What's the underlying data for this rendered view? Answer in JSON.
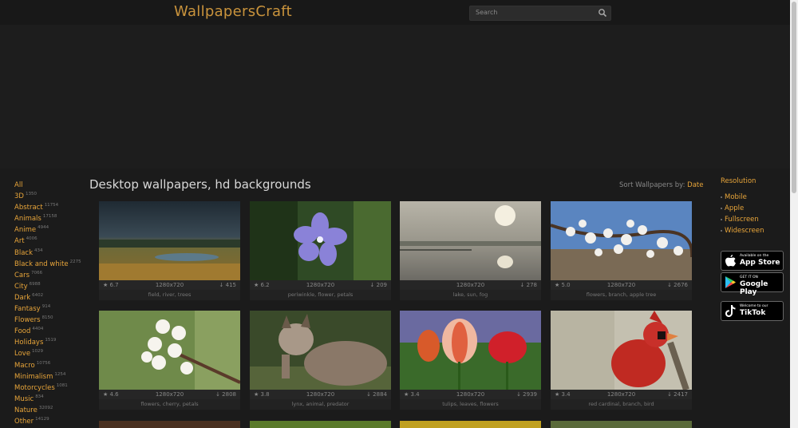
{
  "header": {
    "logo": "WallpapersCraft",
    "search_placeholder": "Search"
  },
  "title": "Desktop wallpapers, hd backgrounds",
  "sort": {
    "label": "Sort Wallpapers by:",
    "value": "Date"
  },
  "categories": [
    {
      "name": "All",
      "count": ""
    },
    {
      "name": "3D",
      "count": "1350"
    },
    {
      "name": "Abstract",
      "count": "11754"
    },
    {
      "name": "Animals",
      "count": "17158"
    },
    {
      "name": "Anime",
      "count": "4944"
    },
    {
      "name": "Art",
      "count": "4006"
    },
    {
      "name": "Black",
      "count": "434"
    },
    {
      "name": "Black and white",
      "count": "2275"
    },
    {
      "name": "Cars",
      "count": "7066"
    },
    {
      "name": "City",
      "count": "6988"
    },
    {
      "name": "Dark",
      "count": "6402"
    },
    {
      "name": "Fantasy",
      "count": "914"
    },
    {
      "name": "Flowers",
      "count": "8150"
    },
    {
      "name": "Food",
      "count": "4404"
    },
    {
      "name": "Holidays",
      "count": "1519"
    },
    {
      "name": "Love",
      "count": "1029"
    },
    {
      "name": "Macro",
      "count": "10756"
    },
    {
      "name": "Minimalism",
      "count": "1254"
    },
    {
      "name": "Motorcycles",
      "count": "1081"
    },
    {
      "name": "Music",
      "count": "834"
    },
    {
      "name": "Nature",
      "count": "32092"
    },
    {
      "name": "Other",
      "count": "14129"
    }
  ],
  "right": {
    "heading": "Resolution",
    "items": [
      "Mobile",
      "Apple",
      "Fullscreen",
      "Widescreen"
    ],
    "stores": [
      {
        "small": "Available on the",
        "big": "App Store"
      },
      {
        "small": "GET IT ON",
        "big": "Google Play"
      },
      {
        "small": "Welcome to our",
        "big": "TikTok"
      }
    ]
  },
  "wallpapers": [
    {
      "rating": "★ 6.7",
      "res": "1280x720",
      "dl": "↓ 415",
      "tags": "field, river, trees"
    },
    {
      "rating": "★ 6.2",
      "res": "1280x720",
      "dl": "↓ 209",
      "tags": "periwinkle, flower, petals"
    },
    {
      "rating": "",
      "res": "1280x720",
      "dl": "↓ 278",
      "tags": "lake, sun, fog"
    },
    {
      "rating": "★ 5.0",
      "res": "1280x720",
      "dl": "↓ 2676",
      "tags": "flowers, branch, apple tree"
    },
    {
      "rating": "★ 4.6",
      "res": "1280x720",
      "dl": "↓ 2808",
      "tags": "flowers, cherry, petals"
    },
    {
      "rating": "★ 3.8",
      "res": "1280x720",
      "dl": "↓ 2884",
      "tags": "lynx, animal, predator"
    },
    {
      "rating": "★ 3.4",
      "res": "1280x720",
      "dl": "↓ 2939",
      "tags": "tulips, leaves, flowers"
    },
    {
      "rating": "★ 3.4",
      "res": "1280x720",
      "dl": "↓ 2417",
      "tags": "red cardinal, branch, bird"
    }
  ]
}
